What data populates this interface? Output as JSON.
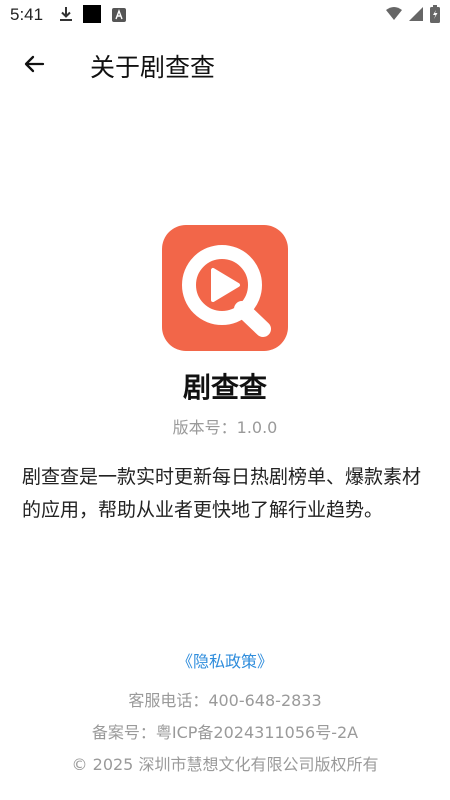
{
  "status_bar": {
    "time": "5:41",
    "icons_left": [
      "download-icon",
      "black-square-icon",
      "a-icon"
    ],
    "icons_right": [
      "wifi-icon",
      "signal-icon",
      "battery-icon"
    ]
  },
  "app_bar": {
    "title": "关于剧查查",
    "back_icon": "arrow-left-icon"
  },
  "app": {
    "name": "剧查查",
    "version": "版本号：1.0.0",
    "description": "剧查查是一款实时更新每日热剧榜单、爆款素材的应用，帮助从业者更快地了解行业趋势。",
    "logo_color": "#f26649"
  },
  "footer": {
    "privacy_link": "《隐私政策》",
    "phone": "客服电话：400-648-2833",
    "icp": "备案号：粤ICP备2024311056号-2A",
    "copyright": "© 2025 深圳市慧想文化有限公司版权所有",
    "link_color": "#2f8ddc"
  }
}
